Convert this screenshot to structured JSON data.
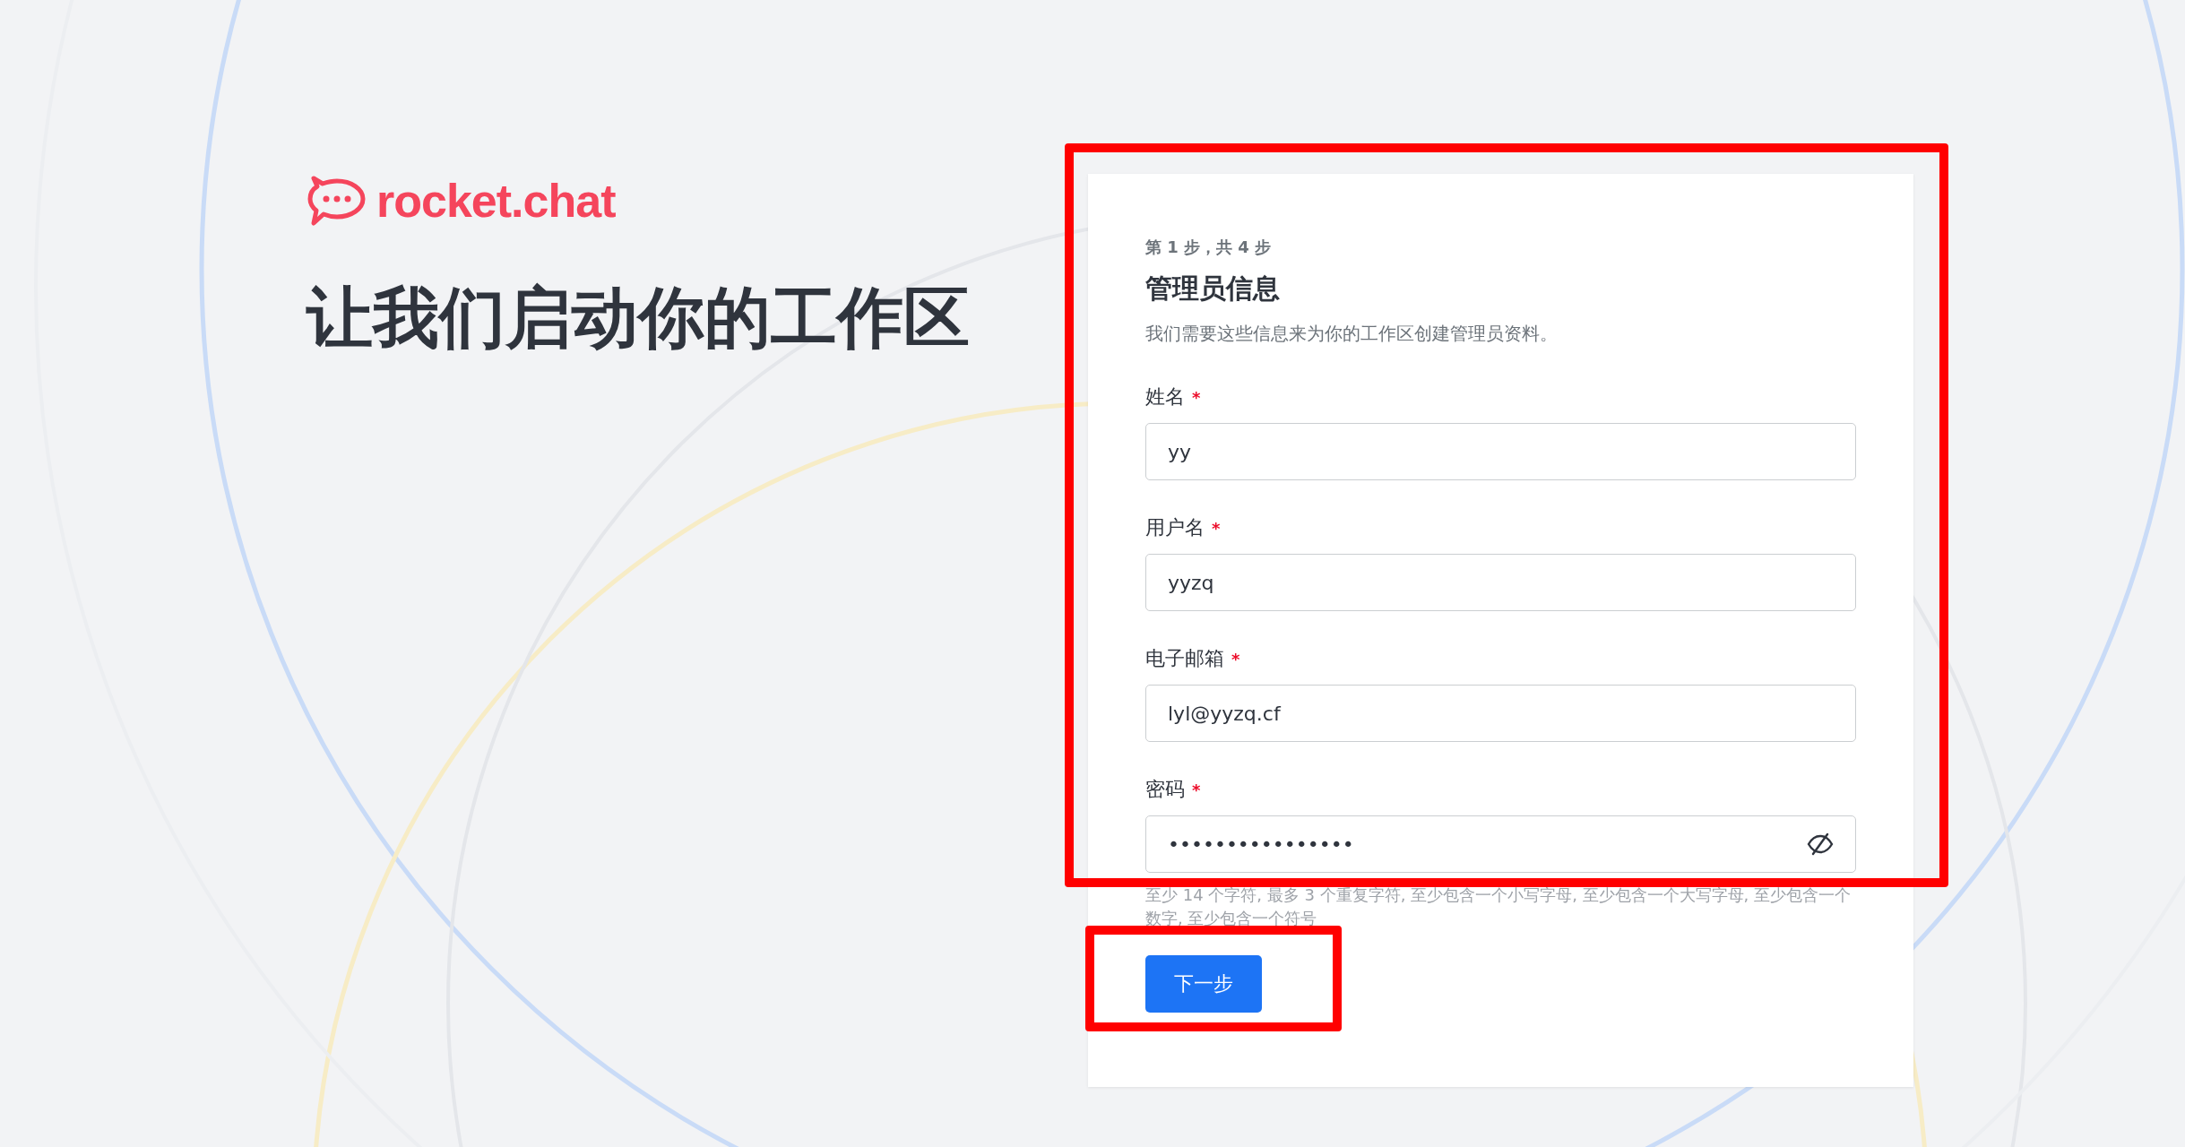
{
  "brand": {
    "name": "rocket.chat"
  },
  "headline": "让我们启动你的工作区",
  "card": {
    "step": "第 1 步，共 4 步",
    "title": "管理员信息",
    "description": "我们需要这些信息来为你的工作区创建管理员资料。",
    "fields": [
      {
        "kind": "text",
        "label": "姓名",
        "required_mark": "*",
        "value": "yy"
      },
      {
        "kind": "text",
        "label": "用户名",
        "required_mark": "*",
        "value": "yyzq"
      },
      {
        "kind": "text",
        "label": "电子邮箱",
        "required_mark": "*",
        "value": "lyl@yyzq.cf"
      },
      {
        "kind": "password",
        "label": "密码",
        "required_mark": "*",
        "value": "••••••••••••••••",
        "revealed": false
      }
    ],
    "hint": "至少 14 个字符, 最多 3 个重复字符, 至少包含一个小写字母, 至少包含一个大写字母, 至少包含一个数字, 至少包含一个符号",
    "next_button": "下一步"
  },
  "highlights": {
    "form": true,
    "next_button": true
  }
}
